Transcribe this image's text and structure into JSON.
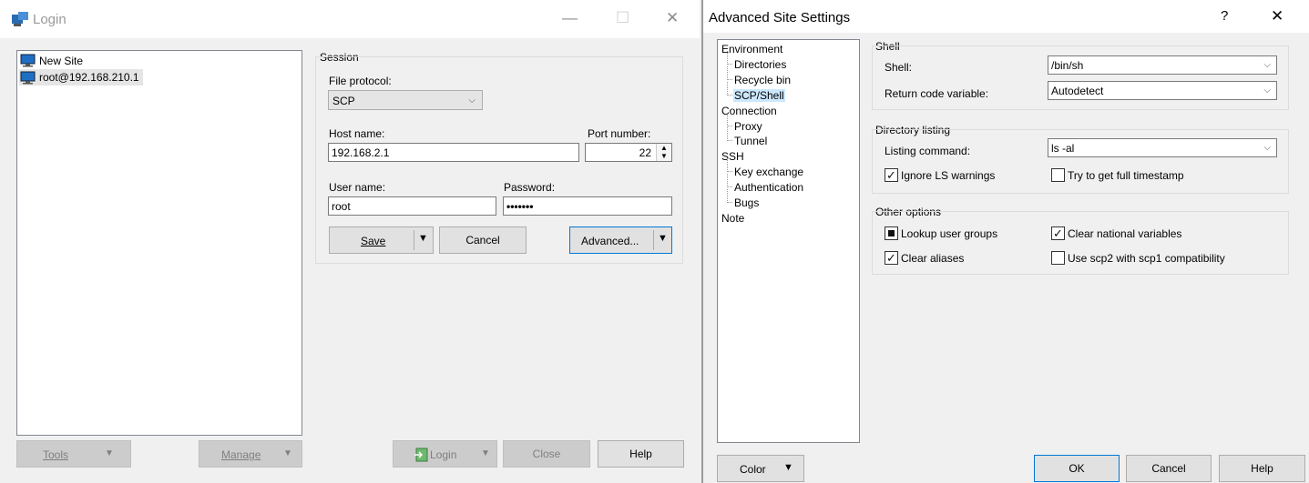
{
  "login": {
    "title": "Login",
    "window_controls": {
      "minimize": "—",
      "maximize": "☐",
      "close": "✕"
    },
    "sites": [
      {
        "label": "New Site"
      },
      {
        "label": "root@192.168.210.1"
      }
    ],
    "session": {
      "group_label": "Session",
      "file_protocol_label": "File protocol:",
      "file_protocol_value": "SCP",
      "host_name_label": "Host name:",
      "host_name_value": "192.168.2.1",
      "port_number_label": "Port number:",
      "port_number_value": "22",
      "user_name_label": "User name:",
      "user_name_value": "root",
      "password_label": "Password:",
      "password_value": "•••••••",
      "save_label": "Save",
      "cancel_label": "Cancel",
      "advanced_label": "Advanced..."
    },
    "bottom": {
      "tools_label": "Tools",
      "manage_label": "Manage",
      "login_label": "Login",
      "close_label": "Close",
      "help_label": "Help"
    }
  },
  "advanced": {
    "title": "Advanced Site Settings",
    "help_glyph": "?",
    "close_glyph": "✕",
    "tree": [
      {
        "label": "Environment",
        "level": 0
      },
      {
        "label": "Directories",
        "level": 1
      },
      {
        "label": "Recycle bin",
        "level": 1
      },
      {
        "label": "SCP/Shell",
        "level": 1,
        "selected": true
      },
      {
        "label": "Connection",
        "level": 0
      },
      {
        "label": "Proxy",
        "level": 1
      },
      {
        "label": "Tunnel",
        "level": 1
      },
      {
        "label": "SSH",
        "level": 0
      },
      {
        "label": "Key exchange",
        "level": 1
      },
      {
        "label": "Authentication",
        "level": 1
      },
      {
        "label": "Bugs",
        "level": 1
      },
      {
        "label": "Note",
        "level": 0
      }
    ],
    "shell_group": {
      "title": "Shell",
      "shell_label": "Shell:",
      "shell_value": "/bin/sh",
      "return_code_label": "Return code variable:",
      "return_code_value": "Autodetect"
    },
    "dir_group": {
      "title": "Directory listing",
      "listing_label": "Listing command:",
      "listing_value": "ls -al",
      "ignore_ls_label": "Ignore LS warnings",
      "ignore_ls_checked": true,
      "full_timestamp_label": "Try to get full timestamp",
      "full_timestamp_checked": false
    },
    "other_group": {
      "title": "Other options",
      "lookup_groups_label": "Lookup user groups",
      "lookup_groups_state": "indeterminate",
      "clear_national_label": "Clear national variables",
      "clear_national_checked": true,
      "clear_aliases_label": "Clear aliases",
      "clear_aliases_checked": true,
      "scp2_label": "Use scp2 with scp1 compatibility",
      "scp2_checked": false
    },
    "buttons": {
      "color_label": "Color",
      "ok_label": "OK",
      "cancel_label": "Cancel",
      "help_label": "Help"
    }
  },
  "colors": {
    "selection": "#cce8ff",
    "focus_border": "#0078d7",
    "monitor_icon": "#1e6fc4"
  }
}
